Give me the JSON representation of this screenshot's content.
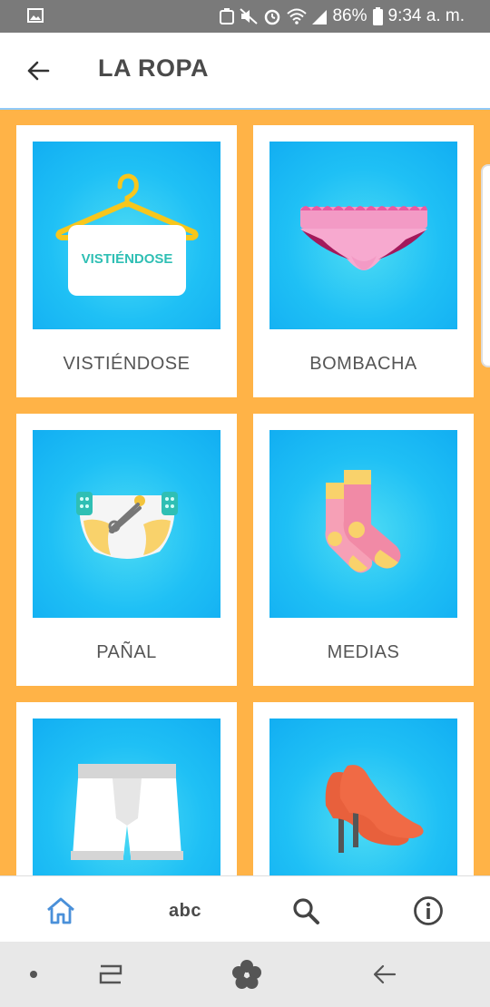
{
  "status_bar": {
    "battery": "86%",
    "time": "9:34 a. m."
  },
  "header": {
    "title": "LA ROPA"
  },
  "cards": [
    {
      "label": "VISTIÉNDOSE",
      "badge": "VISTIÉNDOSE",
      "icon": "hanger-icon"
    },
    {
      "label": "BOMBACHA",
      "icon": "underwear-icon"
    },
    {
      "label": "PAÑAL",
      "icon": "diaper-icon"
    },
    {
      "label": "MEDIAS",
      "icon": "socks-icon"
    },
    {
      "label": "",
      "icon": "boxer-shorts-icon"
    },
    {
      "label": "",
      "icon": "high-heels-icon"
    }
  ],
  "bottom_nav": {
    "abc_label": "abc",
    "active": "home"
  },
  "colors": {
    "background": "#ffb347",
    "tile": "#1fc0f5",
    "nav_active": "#4a90d9"
  }
}
